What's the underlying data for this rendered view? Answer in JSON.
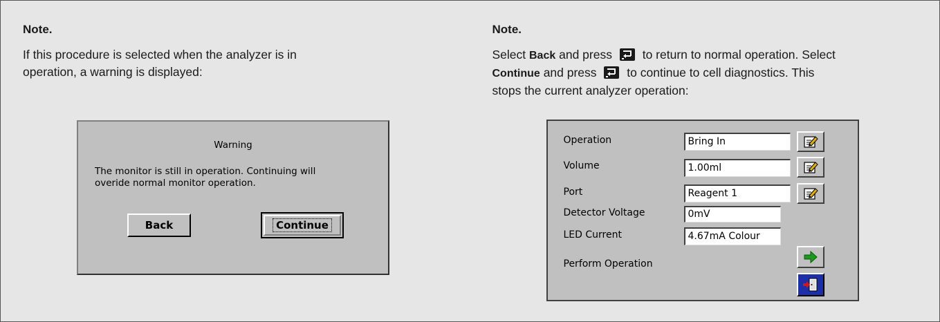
{
  "left_note": {
    "title": "Note.",
    "text_line1": "If this procedure is selected when the analyzer is in",
    "text_line2": "operation, a warning is displayed:"
  },
  "warning_dialog": {
    "title": "Warning",
    "message_line1": "The monitor is still in operation. Continuing will",
    "message_line2": "overide normal monitor operation.",
    "back_label": "Back",
    "continue_label": "Continue"
  },
  "right_note": {
    "title": "Note.",
    "part1": "Select ",
    "back_word": "Back",
    "part2": " and press",
    "part3": "to return to normal operation. Select",
    "continue_word": "Continue",
    "part4": " and press",
    "part5": "to continue to cell diagnostics. This",
    "part6": "stops the current analyzer operation:"
  },
  "diagnostics": {
    "rows": [
      {
        "label": "Operation",
        "value": "Bring In"
      },
      {
        "label": "Volume",
        "value": "1.00ml"
      },
      {
        "label": "Port",
        "value": "Reagent 1"
      },
      {
        "label": "Detector Voltage",
        "value": "0mV"
      },
      {
        "label": "LED Current",
        "value": "4.67mA Colour"
      }
    ],
    "perform_label": "Perform Operation"
  },
  "icons": {
    "enter_key": "enter-key-icon",
    "edit": "edit-icon",
    "go": "green-arrow-right-icon",
    "exit": "exit-door-icon"
  }
}
